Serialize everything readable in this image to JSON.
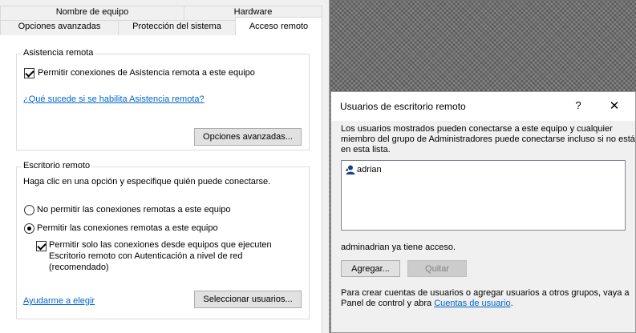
{
  "properties": {
    "tabs_top": [
      {
        "label": "Nombre de equipo"
      },
      {
        "label": "Hardware"
      }
    ],
    "tabs_bottom": [
      {
        "label": "Opciones avanzadas"
      },
      {
        "label": "Protección del sistema"
      },
      {
        "label": "Acceso remoto"
      }
    ],
    "assistance": {
      "title": "Asistencia remota",
      "checkbox_label": "Permitir conexiones de Asistencia remota a este equipo",
      "checked": true,
      "link": "¿Qué sucede si se habilita Asistencia remota?",
      "advanced_button": "Opciones avanzadas..."
    },
    "remote_desktop": {
      "title": "Escritorio remoto",
      "intro": "Haga clic en una opción y especifique quién puede conectarse.",
      "option_deny": "No permitir las conexiones remotas a este equipo",
      "option_allow": "Permitir las conexiones remotas a este equipo",
      "selected": "allow",
      "nla_line1": "Permitir solo las conexiones desde equipos que ejecuten",
      "nla_line2": "Escritorio remoto con Autenticación a nivel de red",
      "nla_line3": "(recomendado)",
      "nla_checked": true,
      "help_link": "Ayudarme a elegir",
      "select_users_button": "Seleccionar usuarios..."
    }
  },
  "users_dialog": {
    "title": "Usuarios de escritorio remoto",
    "help_glyph": "?",
    "close_glyph": "✕",
    "description_line1": "Los usuarios mostrados pueden conectarse a este equipo y cualquier",
    "description_line2": "miembro del grupo de Administradores puede conectarse incluso si no está",
    "description_line3": "en esta lista.",
    "users": [
      {
        "name": "adrian"
      }
    ],
    "access_status": "adminadrian ya tiene acceso.",
    "add_button": "Agregar...",
    "remove_button": "Quitar",
    "footer_text_1": "Para crear cuentas de usuarios o agregar usuarios a otros grupos, vaya a",
    "footer_text_2": "Panel de control y abra",
    "footer_link": "Cuentas de usuario",
    "footer_period": "."
  },
  "colors": {
    "link": "#0066cc",
    "dialog_bg": "#f0f0f0",
    "panel_bg": "#ffffff"
  }
}
